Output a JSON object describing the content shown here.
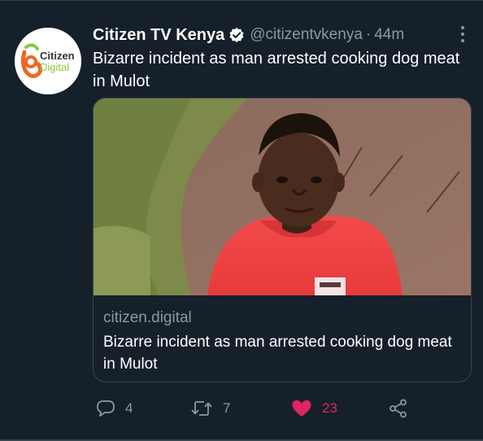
{
  "tweet": {
    "author_name": "Citizen TV Kenya",
    "handle": "@citizentvkenya",
    "separator": "·",
    "time": "44m",
    "text": "Bizarre incident as man arrested cooking dog meat in Mulot",
    "verified": true
  },
  "avatar": {
    "logo_text_top": "Citizen",
    "logo_text_bottom": "Digital"
  },
  "card": {
    "domain": "citizen.digital",
    "title": "Bizarre incident as man arrested cooking dog meat in Mulot"
  },
  "actions": {
    "reply_count": "4",
    "retweet_count": "7",
    "like_count": "23",
    "liked": true
  },
  "icons": {
    "verified": "verified-badge-icon",
    "more": "more-vertical-icon",
    "reply": "reply-icon",
    "retweet": "retweet-icon",
    "like": "heart-icon",
    "share": "share-icon"
  },
  "colors": {
    "background": "#15202b",
    "secondary_text": "#8899a6",
    "like": "#e0245e",
    "border": "#38444d",
    "logo_orange": "#f26522",
    "logo_green": "#8dc63f"
  }
}
